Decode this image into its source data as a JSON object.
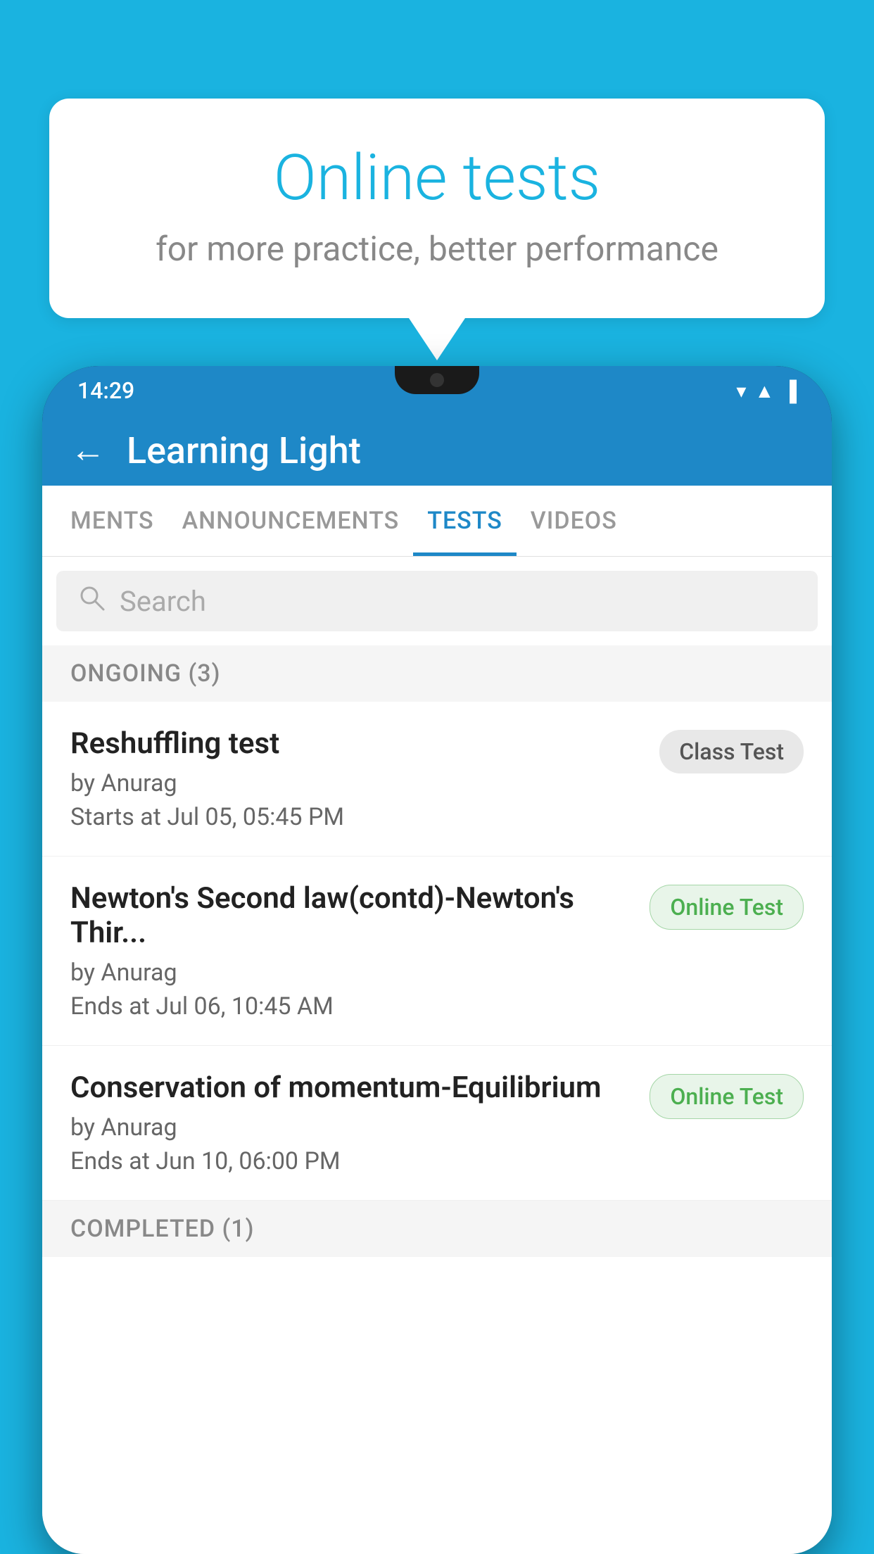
{
  "background_color": "#1ab3e0",
  "speech_bubble": {
    "title": "Online tests",
    "subtitle": "for more practice, better performance"
  },
  "phone": {
    "status_bar": {
      "time": "14:29",
      "icons": [
        "wifi",
        "signal",
        "battery"
      ]
    },
    "app_header": {
      "back_label": "←",
      "title": "Learning Light"
    },
    "tabs": [
      {
        "label": "MENTS",
        "active": false
      },
      {
        "label": "ANNOUNCEMENTS",
        "active": false
      },
      {
        "label": "TESTS",
        "active": true
      },
      {
        "label": "VIDEOS",
        "active": false
      }
    ],
    "search": {
      "placeholder": "Search"
    },
    "sections": [
      {
        "title": "ONGOING (3)",
        "tests": [
          {
            "name": "Reshuffling test",
            "author": "by Anurag",
            "date_label": "Starts at",
            "date": "Jul 05, 05:45 PM",
            "badge": "Class Test",
            "badge_type": "class"
          },
          {
            "name": "Newton's Second law(contd)-Newton's Thir...",
            "author": "by Anurag",
            "date_label": "Ends at",
            "date": "Jul 06, 10:45 AM",
            "badge": "Online Test",
            "badge_type": "online"
          },
          {
            "name": "Conservation of momentum-Equilibrium",
            "author": "by Anurag",
            "date_label": "Ends at",
            "date": "Jun 10, 06:00 PM",
            "badge": "Online Test",
            "badge_type": "online"
          }
        ]
      }
    ],
    "completed_section": {
      "title": "COMPLETED (1)"
    }
  }
}
